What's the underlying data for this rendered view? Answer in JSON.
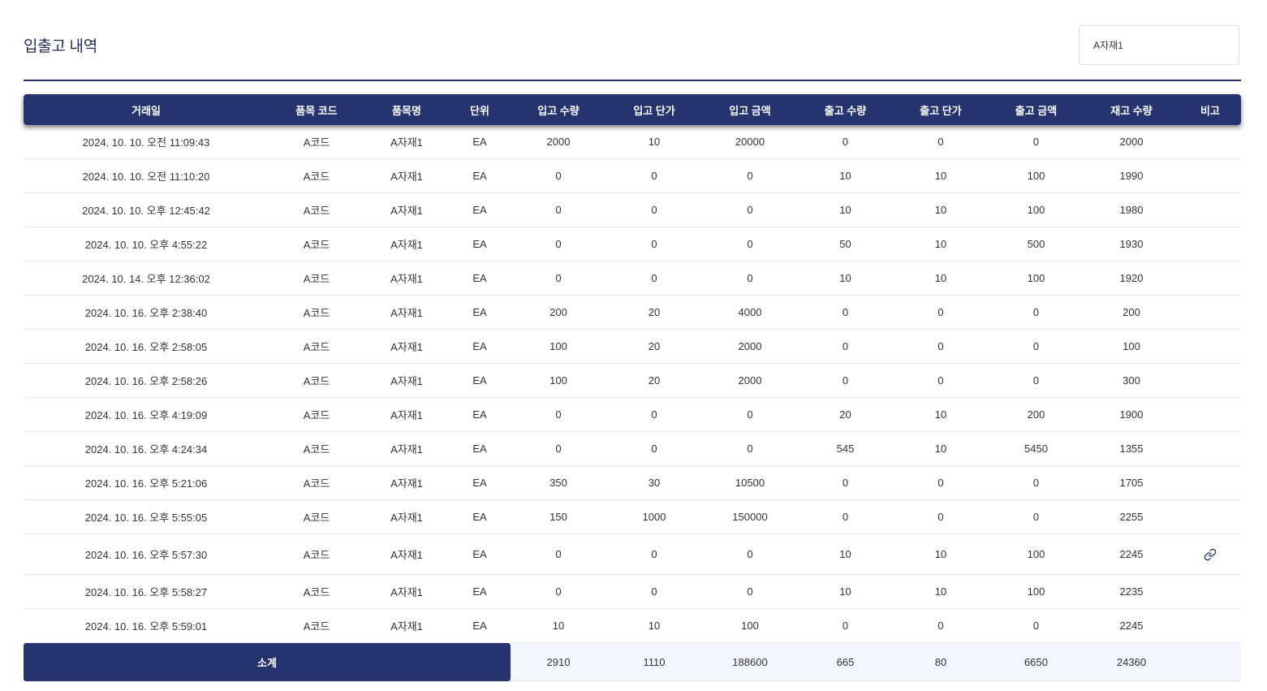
{
  "header": {
    "title": "입출고 내역",
    "search_value": "A자재1"
  },
  "table": {
    "columns": [
      "거래일",
      "품목 코드",
      "품목명",
      "단위",
      "입고 수량",
      "입고 단가",
      "입고 금액",
      "출고 수량",
      "출고 단가",
      "출고 금액",
      "재고 수량",
      "비고"
    ],
    "rows": [
      [
        "2024. 10. 10. 오전 11:09:43",
        "A코드",
        "A자재1",
        "EA",
        "2000",
        "10",
        "20000",
        "0",
        "0",
        "0",
        "2000",
        ""
      ],
      [
        "2024. 10. 10. 오전 11:10:20",
        "A코드",
        "A자재1",
        "EA",
        "0",
        "0",
        "0",
        "10",
        "10",
        "100",
        "1990",
        ""
      ],
      [
        "2024. 10. 10. 오후 12:45:42",
        "A코드",
        "A자재1",
        "EA",
        "0",
        "0",
        "0",
        "10",
        "10",
        "100",
        "1980",
        ""
      ],
      [
        "2024. 10. 10. 오후 4:55:22",
        "A코드",
        "A자재1",
        "EA",
        "0",
        "0",
        "0",
        "50",
        "10",
        "500",
        "1930",
        ""
      ],
      [
        "2024. 10. 14. 오후 12:36:02",
        "A코드",
        "A자재1",
        "EA",
        "0",
        "0",
        "0",
        "10",
        "10",
        "100",
        "1920",
        ""
      ],
      [
        "2024. 10. 16. 오후 2:38:40",
        "A코드",
        "A자재1",
        "EA",
        "200",
        "20",
        "4000",
        "0",
        "0",
        "0",
        "200",
        ""
      ],
      [
        "2024. 10. 16. 오후 2:58:05",
        "A코드",
        "A자재1",
        "EA",
        "100",
        "20",
        "2000",
        "0",
        "0",
        "0",
        "100",
        ""
      ],
      [
        "2024. 10. 16. 오후 2:58:26",
        "A코드",
        "A자재1",
        "EA",
        "100",
        "20",
        "2000",
        "0",
        "0",
        "0",
        "300",
        ""
      ],
      [
        "2024. 10. 16. 오후 4:19:09",
        "A코드",
        "A자재1",
        "EA",
        "0",
        "0",
        "0",
        "20",
        "10",
        "200",
        "1900",
        ""
      ],
      [
        "2024. 10. 16. 오후 4:24:34",
        "A코드",
        "A자재1",
        "EA",
        "0",
        "0",
        "0",
        "545",
        "10",
        "5450",
        "1355",
        ""
      ],
      [
        "2024. 10. 16. 오후 5:21:06",
        "A코드",
        "A자재1",
        "EA",
        "350",
        "30",
        "10500",
        "0",
        "0",
        "0",
        "1705",
        ""
      ],
      [
        "2024. 10. 16. 오후 5:55:05",
        "A코드",
        "A자재1",
        "EA",
        "150",
        "1000",
        "150000",
        "0",
        "0",
        "0",
        "2255",
        ""
      ],
      [
        "2024. 10. 16. 오후 5:57:30",
        "A코드",
        "A자재1",
        "EA",
        "0",
        "0",
        "0",
        "10",
        "10",
        "100",
        "2245",
        "link-icon"
      ],
      [
        "2024. 10. 16. 오후 5:58:27",
        "A코드",
        "A자재1",
        "EA",
        "0",
        "0",
        "0",
        "10",
        "10",
        "100",
        "2235",
        ""
      ],
      [
        "2024. 10. 16. 오후 5:59:01",
        "A코드",
        "A자재1",
        "EA",
        "10",
        "10",
        "100",
        "0",
        "0",
        "0",
        "2245",
        ""
      ]
    ],
    "subtotal": {
      "label": "소계",
      "values": [
        "2910",
        "1110",
        "188600",
        "665",
        "80",
        "6650",
        "24360",
        ""
      ]
    }
  },
  "colors": {
    "primary": "#25346f",
    "subtotal_bg": "#f3f6fc",
    "row_border": "#e3e5ea"
  }
}
